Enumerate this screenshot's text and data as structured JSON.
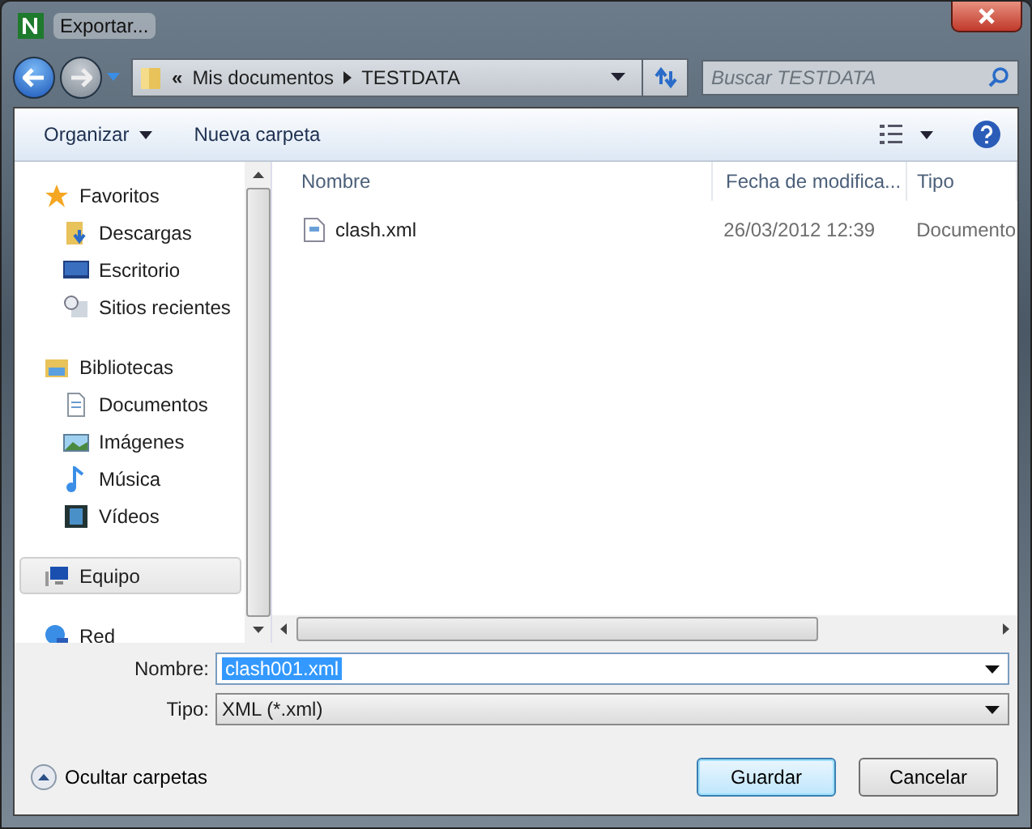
{
  "window": {
    "title": "Exportar..."
  },
  "address": {
    "prefix": "«",
    "crumbs": [
      "Mis documentos",
      "TESTDATA"
    ]
  },
  "search": {
    "placeholder": "Buscar TESTDATA"
  },
  "toolbar": {
    "organize": "Organizar",
    "new_folder": "Nueva carpeta"
  },
  "sidebar": {
    "items": [
      {
        "label": "Favoritos",
        "selected": false,
        "children": [
          {
            "label": "Descargas",
            "selected": false
          },
          {
            "label": "Escritorio",
            "selected": false
          },
          {
            "label": "Sitios recientes",
            "selected": false
          }
        ]
      },
      {
        "label": "Bibliotecas",
        "selected": false,
        "children": [
          {
            "label": "Documentos",
            "selected": false
          },
          {
            "label": "Imágenes",
            "selected": false
          },
          {
            "label": "Música",
            "selected": false
          },
          {
            "label": "Vídeos",
            "selected": false
          }
        ]
      },
      {
        "label": "Equipo",
        "selected": true
      },
      {
        "label": "Red",
        "selected": false
      }
    ]
  },
  "table": {
    "columns": [
      "Nombre",
      "Fecha de modifica...",
      "Tipo"
    ],
    "rows": [
      {
        "cells": [
          "clash.xml",
          "26/03/2012 12:39",
          "Documento"
        ],
        "selected": false
      }
    ]
  },
  "form": {
    "name_label": "Nombre:",
    "name_value": "clash001.xml",
    "type_label": "Tipo:",
    "type_value": "XML (*.xml)"
  },
  "footer": {
    "toggle": "Ocultar carpetas",
    "save": "Guardar",
    "cancel": "Cancelar"
  }
}
